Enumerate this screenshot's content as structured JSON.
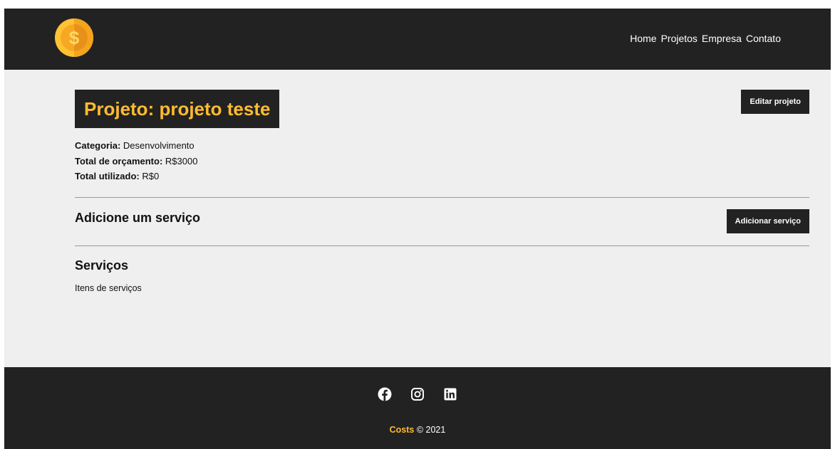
{
  "navbar": {
    "logo_icon": "dollar-coin-icon",
    "links": [
      "Home",
      "Projetos",
      "Empresa",
      "Contato"
    ]
  },
  "project": {
    "title": "Projeto: projeto teste",
    "edit_button": "Editar projeto",
    "info": [
      {
        "label": "Categoria:",
        "value": "Desenvolvimento"
      },
      {
        "label": "Total de orçamento:",
        "value": "R$3000"
      },
      {
        "label": "Total utilizado:",
        "value": "R$0"
      }
    ]
  },
  "add_service": {
    "title": "Adicione um serviço",
    "button": "Adicionar serviço"
  },
  "services": {
    "title": "Serviços",
    "text": "Itens de serviços"
  },
  "footer": {
    "social_icons": [
      "facebook-icon",
      "instagram-icon",
      "linkedin-icon"
    ],
    "brand": "Costs",
    "copyright": " © 2021"
  },
  "colors": {
    "dark": "#222222",
    "accent": "#ffbb33",
    "background": "#efefef"
  }
}
